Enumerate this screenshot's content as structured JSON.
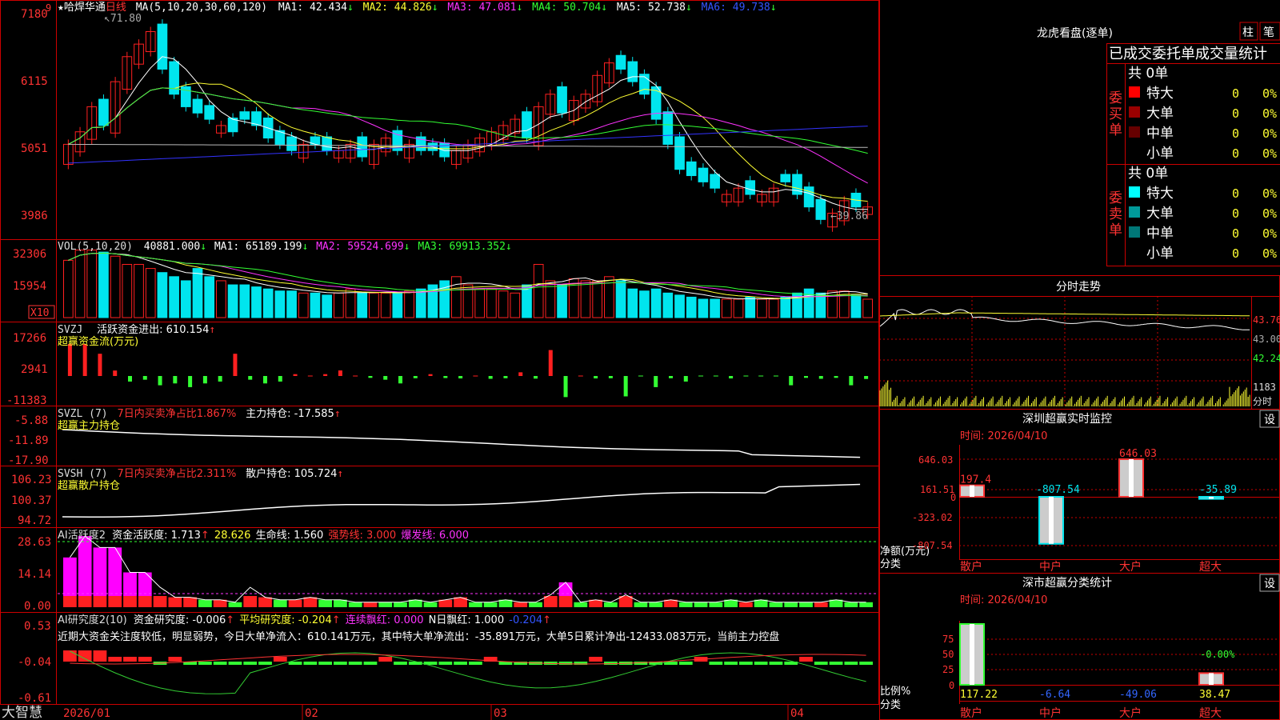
{
  "colors": {
    "up": "#ff2020",
    "down": "#00e5ee",
    "grid": "#cc0000",
    "white": "#ffffff",
    "yellow": "#ffff33",
    "magenta": "#ff33ff",
    "green": "#33ff33",
    "blue": "#3333ff",
    "gray": "#bbbbbb"
  },
  "main_chart": {
    "header": {
      "star": "★",
      "name": "哈焊华通",
      "period": "日线",
      "ma_label": "MA(5,10,20,30,60,120)",
      "ma1": "MA1: 42.434",
      "ma1_arrow": "↓",
      "ma2": "MA2: 44.826",
      "ma2_arrow": "↓",
      "ma3": "MA3: 47.081",
      "ma3_arrow": "↓",
      "ma4": "MA4: 50.704",
      "ma4_arrow": "↓",
      "ma5": "MA5: 52.738",
      "ma5_arrow": "↓",
      "ma6": "MA6: 49.738",
      "ma6_arrow": "↓"
    },
    "y_labels": [
      "7180",
      "6115",
      "5051",
      "3986"
    ],
    "high_label": "71.80",
    "low_label": "39.86",
    "corner_marker": "9"
  },
  "vol_panel": {
    "label": "VOL(5,10,20)",
    "value": "40881.000",
    "arrow": "↓",
    "ma1": "MA1: 65189.199",
    "ma1_arrow": "↓",
    "ma2": "MA2: 59524.699",
    "ma2_arrow": "↓",
    "ma3": "MA3: 69913.352",
    "ma3_arrow": "↓",
    "y_labels": [
      "32306",
      "15954"
    ],
    "unit": "X10"
  },
  "svzj_panel": {
    "label": "SVZJ",
    "label2": "活跃资金进出: 610.154",
    "arrow": "↑",
    "subtitle": "超赢资金流(万元)",
    "y_labels": [
      "17266",
      "2941",
      "-11383"
    ]
  },
  "svzl_panel": {
    "label": "SVZL (7)",
    "label2": "7日内买卖净占比1.867%",
    "label3": "主力持仓: -17.585",
    "arrow": "↑",
    "subtitle": "超赢主力持仓",
    "y_labels": [
      "-5.88",
      "-11.89",
      "-17.90"
    ]
  },
  "svsh_panel": {
    "label": "SVSH (7)",
    "label2": "7日内买卖净占比2.311%",
    "label3": "散户持仓: 105.724",
    "arrow": "↑",
    "subtitle": "超赢散户持仓",
    "y_labels": [
      "106.23",
      "100.37",
      "94.72"
    ]
  },
  "ai_active_panel": {
    "label": "AI活跃度2",
    "label2": "资金活跃度: 1.713",
    "arrow1": "↑",
    "label3": "28.626",
    "label4": "生命线: 1.560",
    "label5": "强势线: 3.000",
    "label6": "爆发线: 6.000",
    "y_labels": [
      "28.63",
      "14.14",
      "0.00"
    ]
  },
  "ai_research_panel": {
    "label": "AI研究度2(10)",
    "label2": "资金研究度: -0.006",
    "arrow1": "↑",
    "label3": "平均研究度: -0.204",
    "arrow2": "↑",
    "label4": "连续飘红: 0.000",
    "label5": "N日飘红: 1.000",
    "label6": "-0.204",
    "arrow3": "↑",
    "note": "近期大资金关注度较低，明显弱势，今日大单净流入：610.141万元，其中特大单净流出：-35.891万元，大单5日累计净出-12433.083万元，当前主力控盘",
    "y_labels": [
      "0.53",
      "-0.04",
      "-0.61"
    ]
  },
  "x_axis": {
    "labels": [
      "2026/01",
      "02",
      "03",
      "04"
    ],
    "brand": "大智慧"
  },
  "right_panel": {
    "dragon": {
      "title": "龙虎看盘(逐单)",
      "btn1": "柱",
      "btn2": "笔",
      "header": "已成交委托单成交量统计",
      "buy_side": "委买单",
      "sell_side": "委卖单",
      "buy_total": "共 0单",
      "sell_total": "共 0单",
      "rows_buy": [
        {
          "name": "特大",
          "count": "0",
          "pct": "0%",
          "color": "#ff0000"
        },
        {
          "name": "大单",
          "count": "0",
          "pct": "0%",
          "color": "#990000"
        },
        {
          "name": "中单",
          "count": "0",
          "pct": "0%",
          "color": "#660000"
        },
        {
          "name": "小单",
          "count": "0",
          "pct": "0%",
          "color": "#000000"
        }
      ],
      "rows_sell": [
        {
          "name": "特大",
          "count": "0",
          "pct": "0%",
          "color": "#00ffff"
        },
        {
          "name": "大单",
          "count": "0",
          "pct": "0%",
          "color": "#009999"
        },
        {
          "name": "中单",
          "count": "0",
          "pct": "0%",
          "color": "#007777"
        },
        {
          "name": "小单",
          "count": "0",
          "pct": "0%",
          "color": "#000000"
        }
      ]
    },
    "intraday": {
      "title": "分时走势",
      "price_labels": [
        "43.76",
        "43.00",
        "42.24"
      ],
      "vol_label": "1183",
      "vol_unit": "分时"
    },
    "monitor": {
      "title": "深圳超赢实时监控",
      "btn": "设",
      "time": "时间: 2026/04/10",
      "y_labels": [
        "646.03",
        "161.51",
        "0",
        "-323.02",
        "-807.54"
      ],
      "ylabel": "净额(万元)",
      "xlabel": "分类",
      "categories": [
        "散户",
        "中户",
        "大户",
        "超大"
      ],
      "values": [
        197.4,
        -807.54,
        646.03,
        -35.89
      ],
      "value_labels": [
        "197.4",
        "-807.54",
        "646.03",
        "-35.89"
      ]
    },
    "stats": {
      "title": "深市超赢分类统计",
      "btn": "设",
      "time": "时间: 2026/04/10",
      "y_labels": [
        "75",
        "50",
        "25",
        "0"
      ],
      "top_label": "-0.00%",
      "ylabel": "比例%",
      "xlabel": "分类",
      "categories": [
        "散户",
        "中户",
        "大户",
        "超大"
      ],
      "values": [
        117.22,
        -6.64,
        -49.06,
        38.47
      ],
      "value_labels": [
        "117.22",
        "-6.64",
        "-49.06",
        "38.47"
      ]
    }
  },
  "chart_data": [
    {
      "type": "candlestick",
      "title": "哈焊华通 日线",
      "x_labels": [
        "2026/01",
        "02",
        "03",
        "04"
      ],
      "ylim": [
        39.86,
        71.8
      ],
      "ohlc_close": [
        52,
        54,
        58,
        55,
        62,
        66,
        68,
        70,
        64,
        60,
        58,
        57,
        56,
        55,
        54,
        56,
        55,
        53,
        52,
        51,
        52,
        52,
        51,
        51,
        52,
        50,
        52,
        53,
        51,
        52,
        51,
        51,
        50,
        51,
        52,
        53,
        54,
        55,
        56,
        53,
        58,
        60,
        57,
        59,
        60,
        63,
        65,
        64,
        62,
        60,
        56,
        52,
        48,
        47,
        46,
        45,
        44,
        45,
        44,
        44,
        45,
        46,
        44,
        42,
        40,
        41,
        43,
        42,
        42
      ],
      "ohlc_dir": [
        1,
        1,
        1,
        -1,
        1,
        1,
        1,
        1,
        -1,
        -1,
        -1,
        -1,
        -1,
        1,
        -1,
        -1,
        -1,
        -1,
        -1,
        -1,
        1,
        -1,
        -1,
        1,
        1,
        -1,
        1,
        1,
        -1,
        1,
        -1,
        -1,
        -1,
        1,
        1,
        1,
        1,
        1,
        1,
        -1,
        1,
        1,
        -1,
        1,
        1,
        1,
        1,
        -1,
        -1,
        -1,
        -1,
        -1,
        -1,
        -1,
        -1,
        -1,
        1,
        1,
        -1,
        1,
        1,
        -1,
        -1,
        -1,
        -1,
        1,
        1,
        -1,
        1
      ]
    },
    {
      "type": "bar",
      "title": "VOL",
      "values": [
        28,
        33,
        33,
        32,
        30,
        26,
        26,
        24,
        22,
        20,
        18,
        24,
        20,
        18,
        16,
        16,
        15,
        14,
        13,
        13,
        12,
        12,
        11,
        12,
        14,
        12,
        12,
        12,
        12,
        13,
        14,
        16,
        18,
        20,
        16,
        14,
        14,
        13,
        12,
        16,
        26,
        18,
        16,
        19,
        18,
        18,
        20,
        18,
        14,
        13,
        14,
        12,
        11,
        10,
        9,
        9,
        9,
        9,
        10,
        9,
        9,
        10,
        12,
        14,
        12,
        13,
        13,
        11,
        9
      ]
    },
    {
      "type": "bar",
      "title": "超赢资金流(万元)",
      "values": [
        17266,
        17266,
        12000,
        2941,
        -3000,
        -2000,
        -5000,
        -4000,
        -6000,
        -4000,
        -3000,
        12000,
        -2000,
        -4000,
        -3000,
        1000,
        800,
        1000,
        3000,
        500,
        -1000,
        -2000,
        -4000,
        -1200,
        1000,
        -1100,
        -1300,
        500,
        -1500,
        -1200,
        2000,
        -1400,
        14000,
        -11383,
        500,
        -1300,
        -1200,
        -11000,
        -300,
        -6000,
        -1200,
        -3000,
        -800,
        -200,
        -1300,
        -600,
        -800,
        -600,
        -5000,
        -1000,
        -1500,
        -1000,
        -5000,
        -1600
      ]
    },
    {
      "type": "bar",
      "title": "AI活跃度2",
      "values": [
        20,
        28.6,
        24,
        24,
        14,
        14,
        8,
        4,
        4,
        3,
        3,
        2,
        8,
        4,
        3,
        3,
        4,
        3,
        3,
        2,
        2,
        2,
        2,
        3,
        2,
        3,
        4,
        2,
        2,
        3,
        2,
        2,
        5,
        10,
        2,
        3,
        2,
        5,
        2,
        2,
        3,
        2,
        2,
        2,
        3,
        2,
        3,
        2,
        2,
        2,
        2,
        3,
        2,
        2
      ]
    }
  ]
}
